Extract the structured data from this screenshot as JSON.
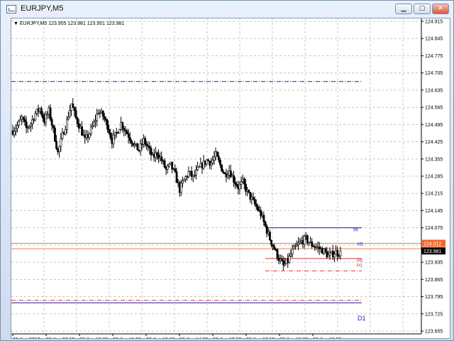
{
  "window": {
    "title": "EURJPY,M5"
  },
  "chart_info": {
    "symbol_tf": "EURJPY,M5",
    "ohlc": "123.955 123.981 123.951 123.981"
  },
  "colors": {
    "grid": "#c8c8c8",
    "candle": "#000000",
    "blue_line": "#1d1daa",
    "red_line": "#d63a3a",
    "orange_line": "#f08040",
    "price_tag_bg": "#f06830",
    "current_tag_bg": "#000000"
  },
  "price_labels": [
    {
      "id": "label-orange",
      "text": "124.012"
    },
    {
      "id": "label-current",
      "text": "123.981"
    }
  ],
  "level_tags": [
    {
      "id": "tag-99",
      "text": "99"
    },
    {
      "id": "tag-m1-green",
      "text": "M1"
    },
    {
      "id": "tag-m5",
      "text": "M5"
    },
    {
      "id": "tag-m1-red",
      "text": "M1"
    },
    {
      "id": "tag-d1",
      "text": "D1"
    }
  ],
  "chart_data": {
    "type": "candlestick",
    "yticks": [
      "124.915",
      "124.845",
      "124.775",
      "124.705",
      "124.635",
      "124.565",
      "124.495",
      "124.425",
      "124.355",
      "124.285",
      "124.215",
      "124.145",
      "124.075",
      "124.005",
      "123.935",
      "123.865",
      "123.795",
      "123.725",
      "123.655"
    ],
    "xticks": [
      "20 Jun 2017",
      "20 Jun 09:15",
      "20 Jun 10:35",
      "20 Jun 11:55",
      "20 Jun 13:15",
      "20 Jun 14:35",
      "20 Jun 15:55",
      "20 Jun 17:15",
      "20 Jun 18:35",
      "20 Jun 19:55"
    ],
    "ylim": [
      123.655,
      124.915
    ],
    "close_path": [
      124.47,
      124.49,
      124.52,
      124.48,
      124.5,
      124.54,
      124.56,
      124.51,
      124.55,
      124.47,
      124.38,
      124.45,
      124.51,
      124.58,
      124.52,
      124.48,
      124.43,
      124.46,
      124.5,
      124.55,
      124.53,
      124.49,
      124.43,
      124.46,
      124.5,
      124.47,
      124.44,
      124.41,
      124.39,
      124.43,
      124.4,
      124.36,
      124.38,
      124.35,
      124.31,
      124.33,
      124.29,
      124.23,
      124.27,
      124.3,
      124.28,
      124.31,
      124.33,
      124.35,
      124.34,
      124.37,
      124.33,
      124.29,
      124.31,
      124.27,
      124.24,
      124.26,
      124.22,
      124.19,
      124.16,
      124.13,
      124.08,
      124.03,
      123.99,
      123.95,
      123.92,
      123.94,
      123.98,
      124.0,
      124.02,
      124.03,
      124.01,
      124.0,
      123.99,
      123.98,
      123.96,
      123.97,
      123.981
    ],
    "horizontal_levels": [
      {
        "price": 124.67,
        "color": "blue_line",
        "style": "dashdot",
        "extent": "left-to-mid"
      },
      {
        "price": 124.075,
        "color": "blue_line",
        "style": "solid",
        "extent": "recent"
      },
      {
        "price": 124.012,
        "color": "orange_line",
        "style": "solid",
        "extent": "full"
      },
      {
        "price": 123.99,
        "color": "orange_line",
        "style": "solid",
        "extent": "full"
      },
      {
        "price": 123.95,
        "color": "red_line",
        "style": "solid",
        "extent": "recent"
      },
      {
        "price": 123.9,
        "color": "red_line",
        "style": "dashdot",
        "extent": "recent"
      },
      {
        "price": 123.78,
        "color": "red_line",
        "style": "dashdot",
        "extent": "left-to-mid"
      },
      {
        "price": 123.77,
        "color": "blue_line",
        "style": "solid",
        "extent": "left-to-mid"
      }
    ]
  }
}
